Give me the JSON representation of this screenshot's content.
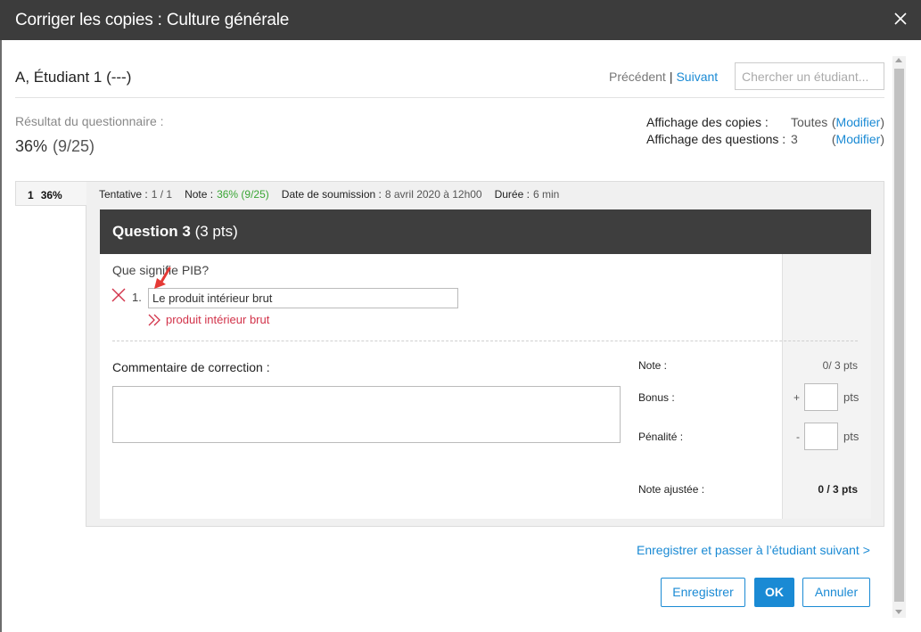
{
  "dialog": {
    "title": "Corriger les copies : Culture générale",
    "close_icon": "close-icon"
  },
  "student": {
    "name": "A, Étudiant 1 (---)"
  },
  "nav": {
    "previous": "Précédent",
    "separator": "|",
    "next": "Suivant",
    "search_placeholder": "Chercher un étudiant..."
  },
  "result": {
    "label": "Résultat du questionnaire :",
    "percent": "36%",
    "fraction": "(9/25)"
  },
  "display": {
    "copies_label": "Affichage des copies :",
    "copies_value": "Toutes",
    "questions_label": "Affichage des questions :",
    "questions_value": "3",
    "paren_open": "(",
    "modify_link": "Modifier",
    "paren_close": ")"
  },
  "attempt_tab": {
    "number": "1",
    "percent": "36%"
  },
  "attempt_info": {
    "attempt_label": "Tentative :",
    "attempt_value": "1 / 1",
    "grade_label": "Note :",
    "grade_value": "36%  (9/25)",
    "date_label": "Date de soumission :",
    "date_value": "8 avril 2020 à 12h00",
    "duration_label": "Durée :",
    "duration_value": "6 min"
  },
  "question": {
    "title": "Question 3",
    "points": "(3 pts)",
    "text": "Que signifie PIB?",
    "answer_number": "1.",
    "student_answer": "Le produit intérieur brut",
    "correct_answer": "produit intérieur brut",
    "comment_label": "Commentaire de correction :"
  },
  "grading": {
    "note_label": "Note :",
    "note_value": "0/ 3 pts",
    "bonus_label": "Bonus :",
    "bonus_sign": "+",
    "penalty_label": "Pénalité :",
    "penalty_sign": "-",
    "unit": "pts",
    "adjusted_label": "Note ajustée :",
    "adjusted_value": "0 / 3 pts"
  },
  "actions": {
    "save_and_next": "Enregistrer et passer à l’étudiant suivant >",
    "save": "Enregistrer",
    "ok": "OK",
    "cancel": "Annuler"
  },
  "colors": {
    "accent": "#1a8ad4",
    "header_bg": "#3c3c3c",
    "wrong": "#d2334a",
    "success": "#3aa635"
  }
}
